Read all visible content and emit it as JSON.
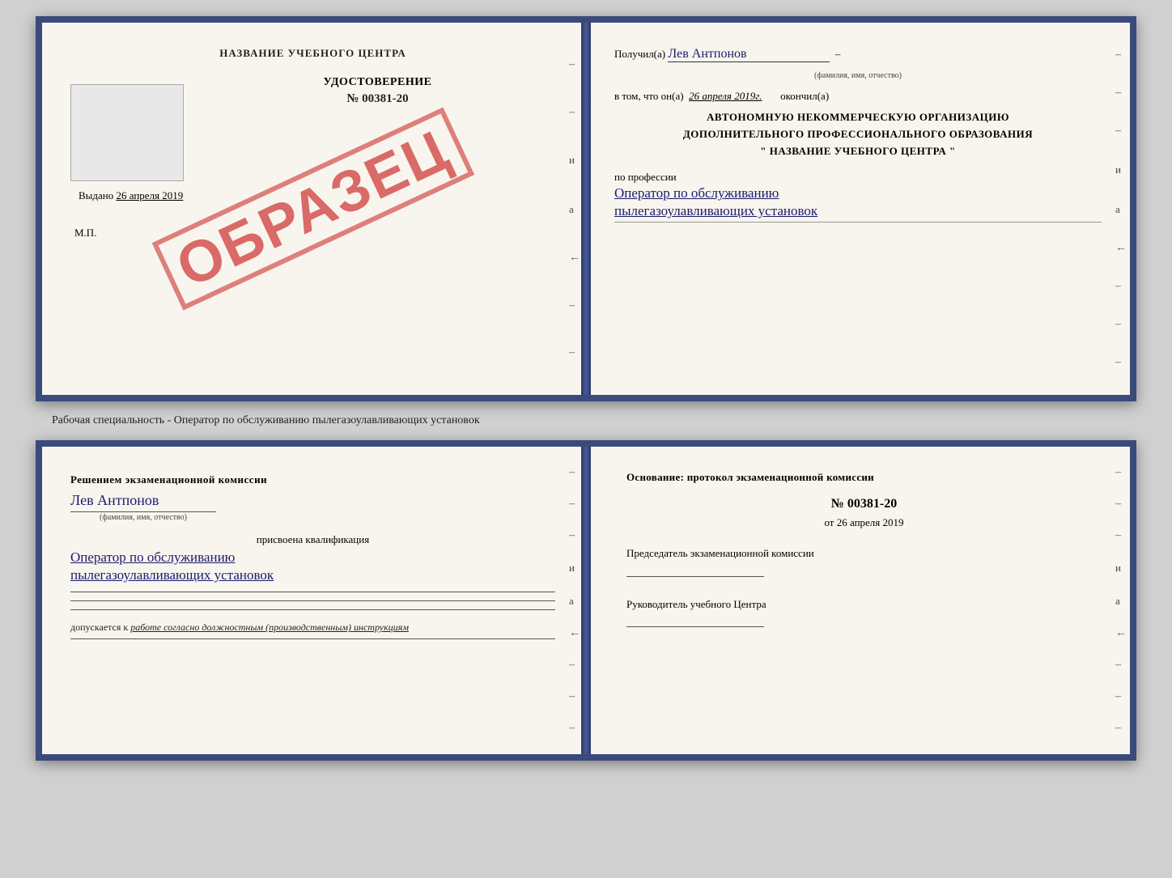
{
  "top_book": {
    "left_page": {
      "title": "НАЗВАНИЕ УЧЕБНОГО ЦЕНТРА",
      "stamp_placeholder": "",
      "doc_title": "УДОСТОВЕРЕНИЕ",
      "doc_number": "№ 00381-20",
      "issued_label": "Выдано",
      "issued_date": "26 апреля 2019",
      "mp_label": "М.П.",
      "obrazets": "ОБРАЗЕЦ"
    },
    "right_page": {
      "received_label": "Получил(а)",
      "recipient_name": "Лев Антпонов",
      "name_subcaption": "(фамилия, имя, отчество)",
      "in_that_label": "в том, что он(а)",
      "completed_date": "26 апреля 2019г.",
      "completed_label": "окончил(а)",
      "org_line1": "АВТОНОМНУЮ НЕКОММЕРЧЕСКУЮ ОРГАНИЗАЦИЮ",
      "org_line2": "ДОПОЛНИТЕЛЬНОГО ПРОФЕССИОНАЛЬНОГО ОБРАЗОВАНИЯ",
      "org_name_quotes_open": "\"",
      "org_name": "НАЗВАНИЕ УЧЕБНОГО ЦЕНТРА",
      "org_name_quotes_close": "\"",
      "profession_label": "по профессии",
      "profession_line1": "Оператор по обслуживанию",
      "profession_line2": "пылегазоулавливающих установок"
    }
  },
  "middle_text": "Рабочая специальность - Оператор по обслуживанию пылегазоулавливающих установок",
  "bottom_book": {
    "left_page": {
      "decision_text": "Решением экзаменационной комиссии",
      "person_name": "Лев Антпонов",
      "name_subcaption": "(фамилия, имя, отчество)",
      "qualification_label": "присвоена квалификация",
      "qualification_line1": "Оператор по обслуживанию",
      "qualification_line2": "пылегазоулавливающих установок",
      "allowed_label": "допускается к",
      "allowed_text": "работе согласно должностным (производственным) инструкциям"
    },
    "right_page": {
      "basis_label": "Основание: протокол экзаменационной комиссии",
      "protocol_number": "№ 00381-20",
      "protocol_date_prefix": "от",
      "protocol_date": "26 апреля 2019",
      "chairman_label": "Председатель экзаменационной комиссии",
      "head_label": "Руководитель учебного Центра"
    }
  }
}
